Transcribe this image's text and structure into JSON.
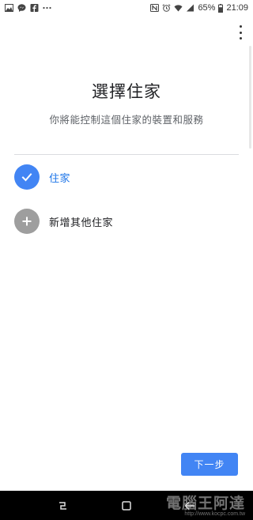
{
  "status_bar": {
    "battery": "65%",
    "time": "21:09",
    "left_icons": [
      "gallery-icon",
      "messenger-icon",
      "facebook-icon",
      "more-notifications-icon"
    ],
    "right_icons": [
      "nfc-icon",
      "alarm-icon",
      "wifi-icon",
      "signal-icon",
      "battery-icon"
    ]
  },
  "header": {
    "title": "選擇住家",
    "subtitle": "你將能控制這個住家的裝置和服務"
  },
  "homes": [
    {
      "label": "住家",
      "icon": "check-icon",
      "selected": true
    },
    {
      "label": "新增其他住家",
      "icon": "plus-icon",
      "selected": false
    }
  ],
  "actions": {
    "next_label": "下一步"
  },
  "colors": {
    "accent": "#4285f4",
    "selected_text": "#1a73e8",
    "add_circle": "#9e9e9e"
  },
  "watermark": {
    "text": "電腦王阿達",
    "url": "http://www.kocpc.com.tw"
  }
}
